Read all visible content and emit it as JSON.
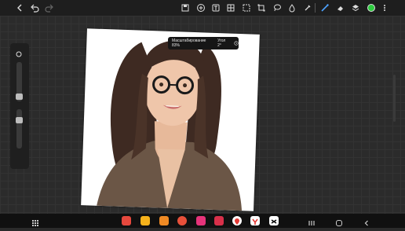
{
  "toolbar": {
    "icons": [
      "back-icon",
      "undo-icon",
      "redo-icon",
      "save-icon",
      "add-icon",
      "text-icon",
      "grid-icon",
      "selection-icon",
      "transform-icon",
      "lasso-icon",
      "fill-icon",
      "eyedropper-icon",
      "brush-icon",
      "eraser-icon",
      "layers-icon",
      "color-swatch-icon",
      "more-icon"
    ],
    "accent_color": "#2ecc40"
  },
  "tooltip": {
    "zoom_text": "Масштабирование 83%",
    "angle_text": "Угол 2°"
  },
  "taskbar": {
    "apps": [
      "app-grid-icon",
      "app-red-icon",
      "app-yellow-icon",
      "app-orange-icon",
      "app-pink-icon",
      "app-camera-icon",
      "app-maps-icon",
      "app-yandex-icon",
      "app-capcut-icon"
    ]
  }
}
